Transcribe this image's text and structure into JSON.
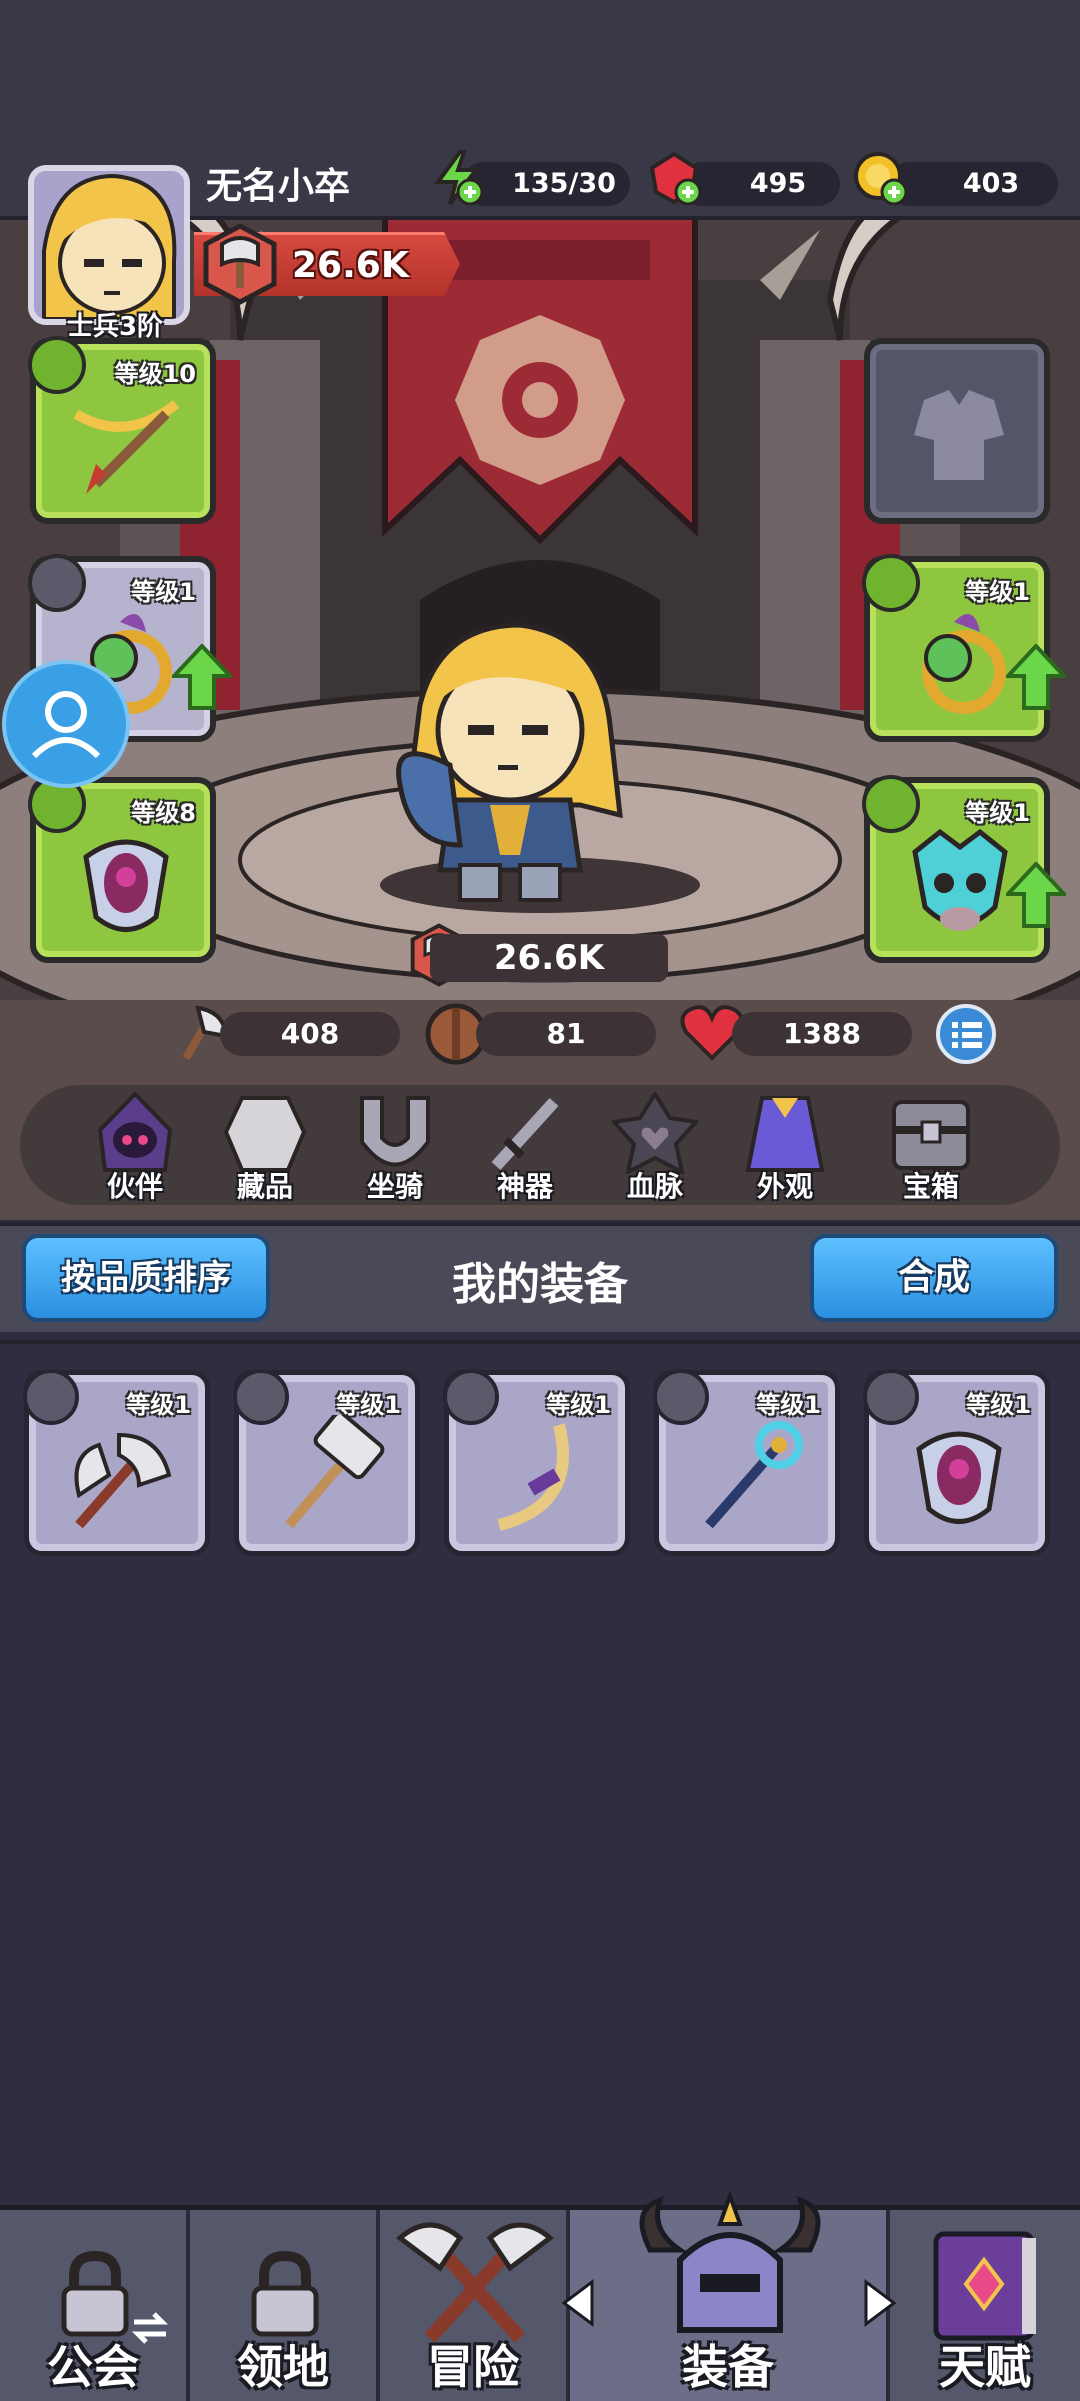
{
  "player": {
    "name": "无名小卒",
    "rank": "士兵3阶",
    "power": "26.6K"
  },
  "resources": {
    "energy": "135/30",
    "gems": "495",
    "coins": "403"
  },
  "slots": {
    "weapon_level": "等级10",
    "armor_level": "",
    "ring_left_level": "等级1",
    "ring_right_level": "等级1",
    "necklace_left_level": "等级8",
    "necklace_right_level": "等级1"
  },
  "stats": {
    "power": "26.6K",
    "attack": "408",
    "defense": "81",
    "hp": "1388"
  },
  "menu": [
    {
      "label": "伙伴",
      "icon": "hooded-companion-icon"
    },
    {
      "label": "藏品",
      "icon": "stone-collection-icon"
    },
    {
      "label": "坐骑",
      "icon": "horseshoe-mount-icon"
    },
    {
      "label": "神器",
      "icon": "artifact-sword-icon"
    },
    {
      "label": "血脉",
      "icon": "bloodline-emblem-icon"
    },
    {
      "label": "外观",
      "icon": "cape-appearance-icon"
    },
    {
      "label": "宝箱",
      "icon": "treasure-chest-icon"
    }
  ],
  "equipment": {
    "sort_button": "按品质排序",
    "title": "我的装备",
    "merge_button": "合成",
    "items": [
      {
        "level": "等级1",
        "icon": "axe-icon"
      },
      {
        "level": "等级1",
        "icon": "hammer-icon"
      },
      {
        "level": "等级1",
        "icon": "bow-icon"
      },
      {
        "level": "等级1",
        "icon": "staff-icon"
      },
      {
        "level": "等级1",
        "icon": "pendant-icon"
      }
    ]
  },
  "nav": {
    "guild": "公会",
    "territory": "领地",
    "adventure": "冒险",
    "equipment": "装备",
    "talent": "天赋"
  },
  "colors": {
    "accent_blue": "#3aa0ff",
    "rare_green": "#8ec63f",
    "common_grey": "#a9a6c8",
    "power_red": "#c73b32"
  }
}
